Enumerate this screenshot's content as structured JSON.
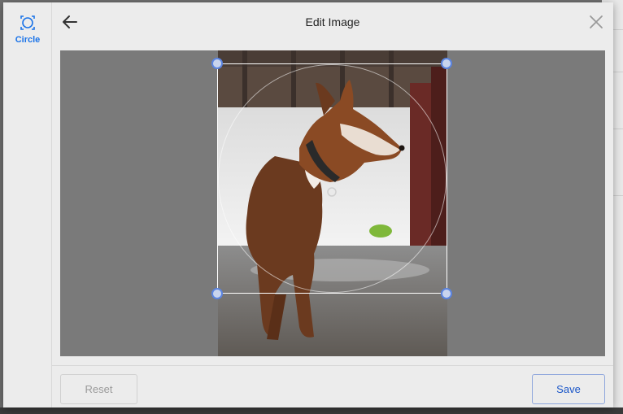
{
  "dialog": {
    "title": "Edit Image",
    "back_icon": "arrow-left-icon",
    "close_icon": "close-icon"
  },
  "sidebar": {
    "tools": [
      {
        "label": "Circle",
        "icon": "circle-crop-icon",
        "active": true
      }
    ]
  },
  "canvas": {
    "image_subject": "photo",
    "crop_shape": "circle"
  },
  "footer": {
    "reset_label": "Reset",
    "save_label": "Save"
  },
  "colors": {
    "accent": "#1a73e8",
    "handle_fill": "#c8d4ee",
    "handle_border": "#5b84e0",
    "canvas_bg": "#7a7a7a",
    "panel_bg": "#ececec"
  }
}
